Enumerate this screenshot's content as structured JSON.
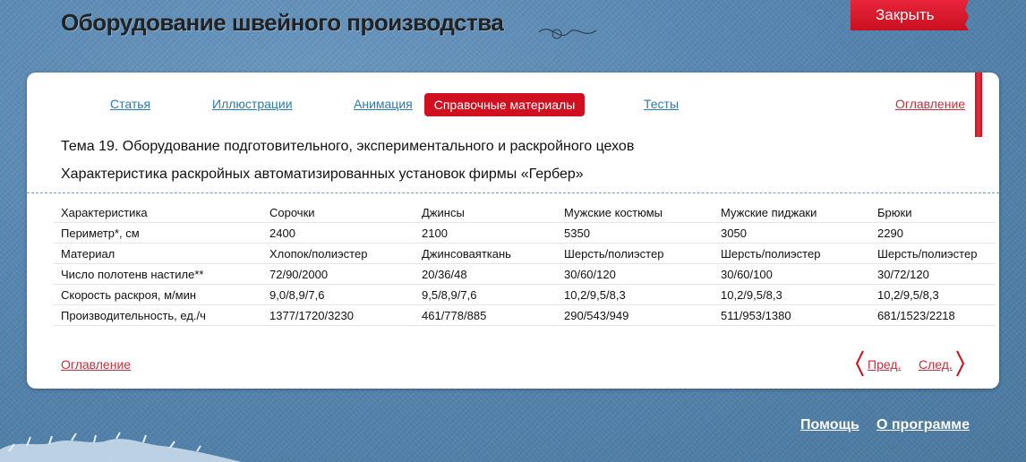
{
  "header": {
    "title": "Оборудование швейного производства",
    "close_label": "Закрыть"
  },
  "tabs": [
    {
      "label": "Статья",
      "active": false
    },
    {
      "label": "Иллюстрации",
      "active": false
    },
    {
      "label": "Анимация",
      "active": false
    },
    {
      "label": "Справочные материалы",
      "active": true
    },
    {
      "label": "Тесты",
      "active": false
    }
  ],
  "toc_label": "Оглавление",
  "content": {
    "topic": "Тема 19. Оборудование подготовительного, экспериментального и раскройного цехов",
    "subtitle": "Характеристика раскройных автоматизированных установок фирмы «Гербер»"
  },
  "table": {
    "headers": [
      "Характеристика",
      "Сорочки",
      "Джинсы",
      "Мужские костюмы",
      "Мужские пиджаки",
      "Брюки"
    ],
    "rows": [
      [
        "Периметр*, см",
        "2400",
        "2100",
        "5350",
        "3050",
        "2290"
      ],
      [
        "Материал",
        "Хлопок/полиэстер",
        "Джинсоваяткань",
        "Шерсть/полиэстер",
        "Шерсть/полиэстер",
        "Шерсть/полиэстер"
      ],
      [
        "Число полотенв настиле**",
        "72/90/2000",
        "20/36/48",
        "30/60/120",
        "30/60/100",
        "30/72/120"
      ],
      [
        "Скорость раскроя, м/мин",
        "9,0/8,9/7,6",
        "9,5/8,9/7,6",
        "10,2/9,5/8,3",
        "10,2/9,5/8,3",
        "10,2/9,5/8,3"
      ],
      [
        "Производительность, ед./ч",
        "1377/1720/3230",
        "461/778/885",
        "290/543/949",
        "511/953/1380",
        "681/1523/2218"
      ]
    ]
  },
  "pager": {
    "prev_label": "Пред.",
    "next_label": "След."
  },
  "footer": {
    "help_label": "Помощь",
    "about_label": "О программе"
  },
  "colors": {
    "accent": "#d0101f",
    "link": "#2a7ab0",
    "red_link": "#c2303e",
    "background": "#4f7fa8"
  }
}
